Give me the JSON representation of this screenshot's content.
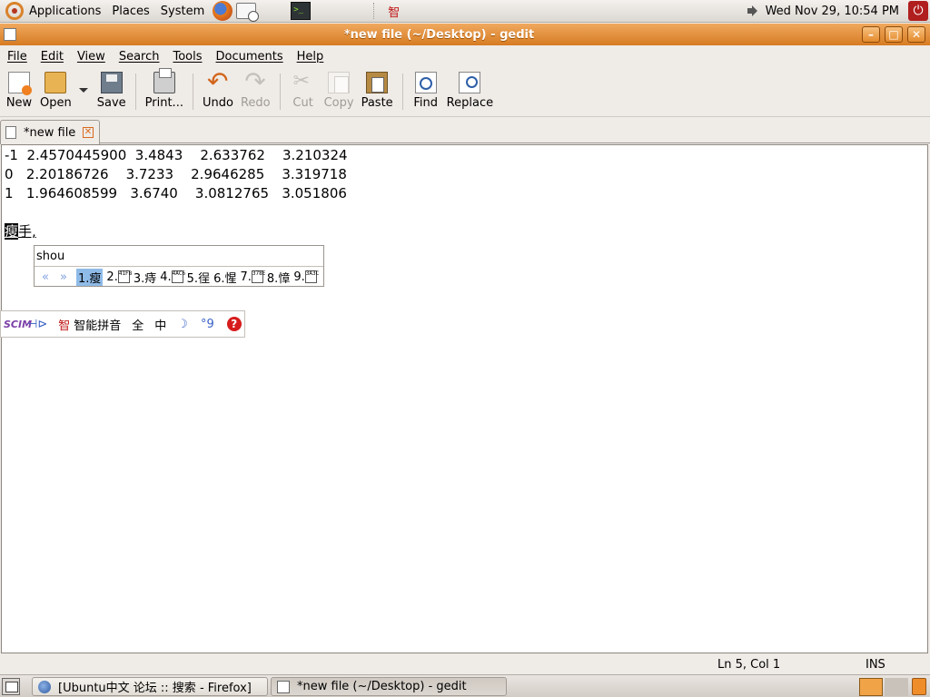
{
  "top_panel": {
    "menus": [
      "Applications",
      "Places",
      "System"
    ],
    "launchers": [
      "firefox-icon",
      "mail-icon",
      "terminal-icon"
    ],
    "ime_indicator": "智",
    "clock": "Wed Nov 29, 10:54 PM"
  },
  "window": {
    "title": "*new file (~/Desktop) - gedit",
    "controls": [
      "minimize",
      "maximize",
      "close"
    ]
  },
  "menubar": [
    "File",
    "Edit",
    "View",
    "Search",
    "Tools",
    "Documents",
    "Help"
  ],
  "toolbar": {
    "new": "New",
    "open": "Open",
    "save": "Save",
    "print": "Print...",
    "undo": "Undo",
    "redo": "Redo",
    "cut": "Cut",
    "copy": "Copy",
    "paste": "Paste",
    "find": "Find",
    "replace": "Replace"
  },
  "tab": {
    "label": "*new file"
  },
  "editor": {
    "lines": [
      "-1  2.4570445900  3.4843    2.633762    3.210324",
      "0   2.20186726    3.7233    2.9646285    3.319718",
      "1   1.964608599   3.6740    3.0812765   3.051806"
    ],
    "preedit_selected": "瘦",
    "preedit_rest": "手,"
  },
  "candidate_window": {
    "pinyin": "shou",
    "candidates": [
      {
        "index": "1.",
        "text": "瘦",
        "active": true
      },
      {
        "index": "2.",
        "glyph": "41F8"
      },
      {
        "index": "3.",
        "text": "痔"
      },
      {
        "index": "4.",
        "glyph": "4AC6"
      },
      {
        "index": "5.",
        "text": "徎"
      },
      {
        "index": "6.",
        "text": "惺"
      },
      {
        "index": "7.",
        "glyph": "378E"
      },
      {
        "index": "8.",
        "text": "慞"
      },
      {
        "index": "9.",
        "glyph": "3A3C"
      }
    ]
  },
  "ime_bar": {
    "logo": "SCIM",
    "mode_name": "智能拼音",
    "full_width": "全",
    "lang": "中",
    "icons": [
      "pin-icon",
      "moon-icon",
      "quote-icon",
      "help-icon"
    ]
  },
  "statusbar": {
    "position": "Ln 5, Col 1",
    "mode": "INS"
  },
  "taskbar": {
    "tasks": [
      {
        "label": "[Ubuntu中文 论坛 :: 搜索 - Firefox]",
        "active": false
      },
      {
        "label": "*new file (~/Desktop) - gedit",
        "active": true
      }
    ]
  },
  "colors": {
    "titlebar": "#d67b22",
    "panel": "#efebe7",
    "candidate_highlight": "#8fbbe8"
  }
}
